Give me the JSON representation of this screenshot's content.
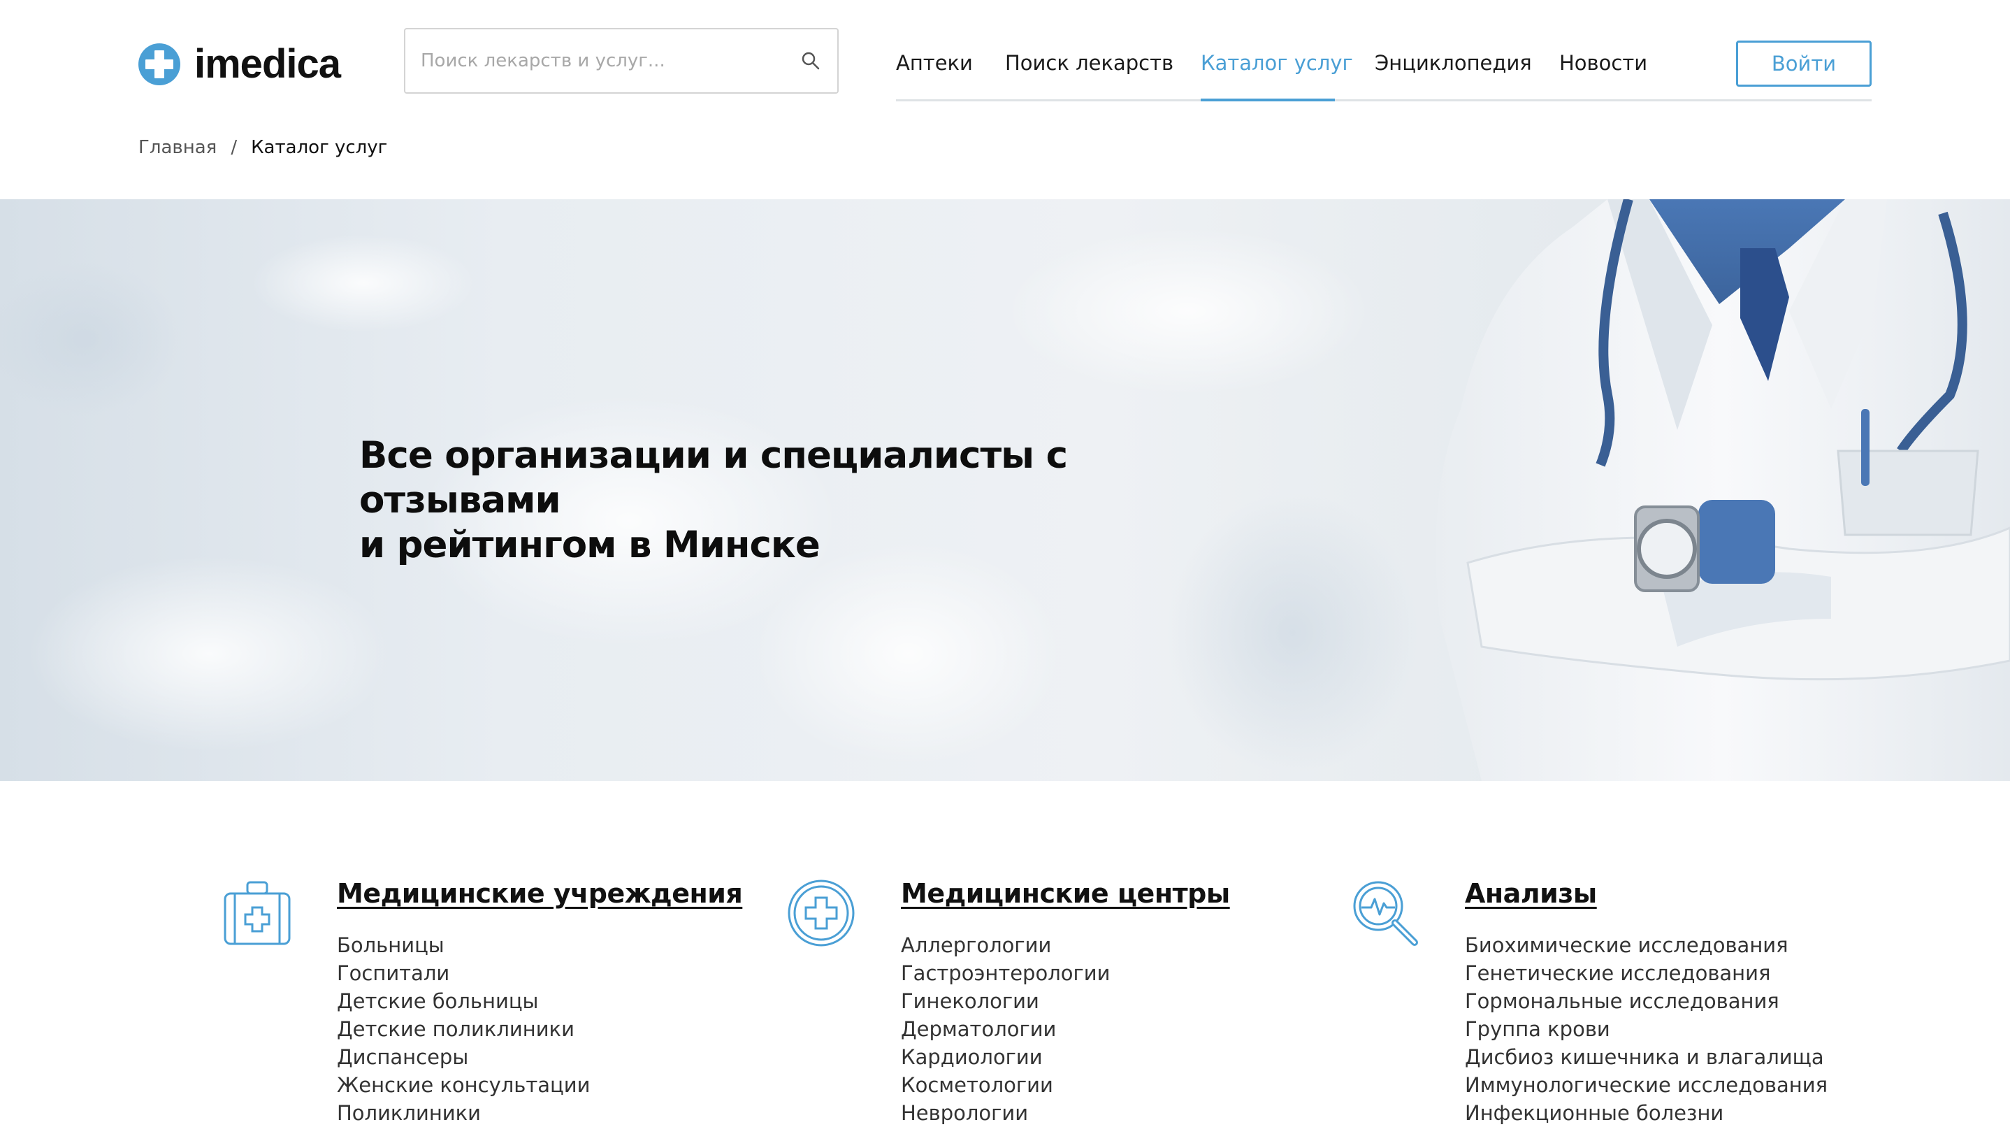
{
  "header": {
    "logo_text": "imedica",
    "search": {
      "placeholder": "Поиск лекарств и услуг..."
    },
    "nav": [
      {
        "label": "Аптеки"
      },
      {
        "label": "Поиск лекарств"
      },
      {
        "label": "Каталог услуг",
        "active": true
      },
      {
        "label": "Энциклопедия"
      },
      {
        "label": "Новости"
      }
    ],
    "login_label": "Войти"
  },
  "breadcrumb": {
    "home": "Главная",
    "separator": "/",
    "current": "Каталог услуг"
  },
  "hero": {
    "title_line1": "Все организации и специалисты с отзывами",
    "title_line2": "и рейтингом в Минске"
  },
  "categories": [
    {
      "title": "Медицинские учреждения",
      "icon": "medical-bag-icon",
      "items": [
        "Больницы",
        "Госпитали",
        "Детские больницы",
        "Детские поликлиники",
        "Диспансеры",
        "Женские консультации",
        "Поликлиники"
      ]
    },
    {
      "title": "Медицинские центры",
      "icon": "medical-cross-circle-icon",
      "items": [
        "Аллергологии",
        "Гастроэнтерологии",
        "Гинекологии",
        "Дерматологии",
        "Кардиологии",
        "Косметологии",
        "Неврологии"
      ]
    },
    {
      "title": "Анализы",
      "icon": "magnifier-pulse-icon",
      "items": [
        "Биохимические исследования",
        "Генетические исследования",
        "Гормональные исследования",
        "Группа крови",
        "Дисбиоз кишечника и влагалища",
        "Иммунологические исследования",
        "Инфекционные болезни"
      ]
    }
  ],
  "colors": {
    "accent": "#4a9fd5",
    "text": "#1a1a1a",
    "muted": "#555555",
    "border": "#d4d4d4"
  }
}
